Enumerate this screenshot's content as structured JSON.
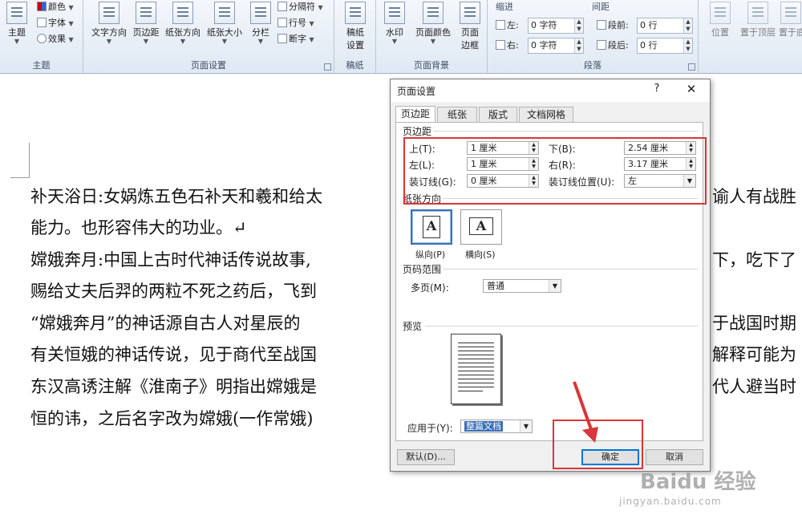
{
  "ribbon": {
    "theme_group": {
      "label": "主题",
      "theme_button": "主题",
      "colors": "颜色",
      "fonts": "字体",
      "effects": "效果"
    },
    "page_setup_group": {
      "label": "页面设置",
      "text_direction": "文字方向",
      "margins": "页边距",
      "orientation": "纸张方向",
      "size": "纸张大小",
      "columns": "分栏",
      "breaks": "分隔符",
      "line_numbers": "行号",
      "hyphenation": "断字"
    },
    "manuscript_group": {
      "label": "稿纸",
      "manuscript_setup_line1": "稿纸",
      "manuscript_setup_line2": "设置"
    },
    "page_background_group": {
      "label": "页面背景",
      "watermark": "水印",
      "page_color": "页面颜色",
      "page_border_line1": "页面",
      "page_border_line2": "边框"
    },
    "paragraph_group": {
      "label": "段落",
      "indent_title": "缩进",
      "spacing_title": "间距",
      "indent_left_label": "左:",
      "indent_left_value": "0 字符",
      "indent_right_label": "右:",
      "indent_right_value": "0 字符",
      "spacing_before_label": "段前:",
      "spacing_before_value": "0 行",
      "spacing_after_label": "段后:",
      "spacing_after_value": "0 行"
    },
    "arrange_group": {
      "position": "位置",
      "bring_forward": "置于顶层",
      "send_backward": "置于底"
    }
  },
  "document": {
    "lines": [
      "补天浴日:女娲炼五色石补天和羲和给太",
      "能力。也形容伟大的功业。↵",
      "嫦娥奔月:中国上古时代神话传说故事,",
      "赐给丈夫后羿的两粒不死之药后，飞到",
      "“嫦娥奔月”的神话源自古人对星辰的",
      "有关恒娥的神话传说，见于商代至战国",
      "东汉高诱注解《淮南子》明指出嫦娥是",
      "恒的讳，之后名字改为嫦娥(一作常娥)"
    ],
    "right_fragments": [
      "谕人有战胜",
      "下，吃下了",
      "于战国时期",
      "解释可能为",
      "代人避当时"
    ]
  },
  "dialog": {
    "title": "页面设置",
    "help": "?",
    "close": "✕",
    "tabs": [
      "页边距",
      "纸张",
      "版式",
      "文档网格"
    ],
    "margins_section": "页边距",
    "top_label": "上(T):",
    "top_value": "1 厘米",
    "bottom_label": "下(B):",
    "bottom_value": "2.54 厘米",
    "left_label": "左(L):",
    "left_value": "1 厘米",
    "right_label": "右(R):",
    "right_value": "3.17 厘米",
    "gutter_label": "装订线(G):",
    "gutter_value": "0 厘米",
    "gutter_pos_label": "装订线位置(U):",
    "gutter_pos_value": "左",
    "orientation_section": "纸张方向",
    "portrait_label": "纵向(P)",
    "landscape_label": "横向(S)",
    "orientation_glyph": "A",
    "pages_section": "页码范围",
    "multiple_pages_label": "多页(M):",
    "multiple_pages_value": "普通",
    "preview_section": "预览",
    "apply_to_label": "应用于(Y):",
    "apply_to_value": "整篇文档",
    "default_button": "默认(D)...",
    "ok_button": "确定",
    "cancel_button": "取消"
  },
  "watermark": {
    "brand": "Baidu 经验",
    "site": "jingyan.baidu.com"
  },
  "colors": {
    "annotation_red": "#d9353a",
    "selection_blue": "#3b6fb6"
  }
}
